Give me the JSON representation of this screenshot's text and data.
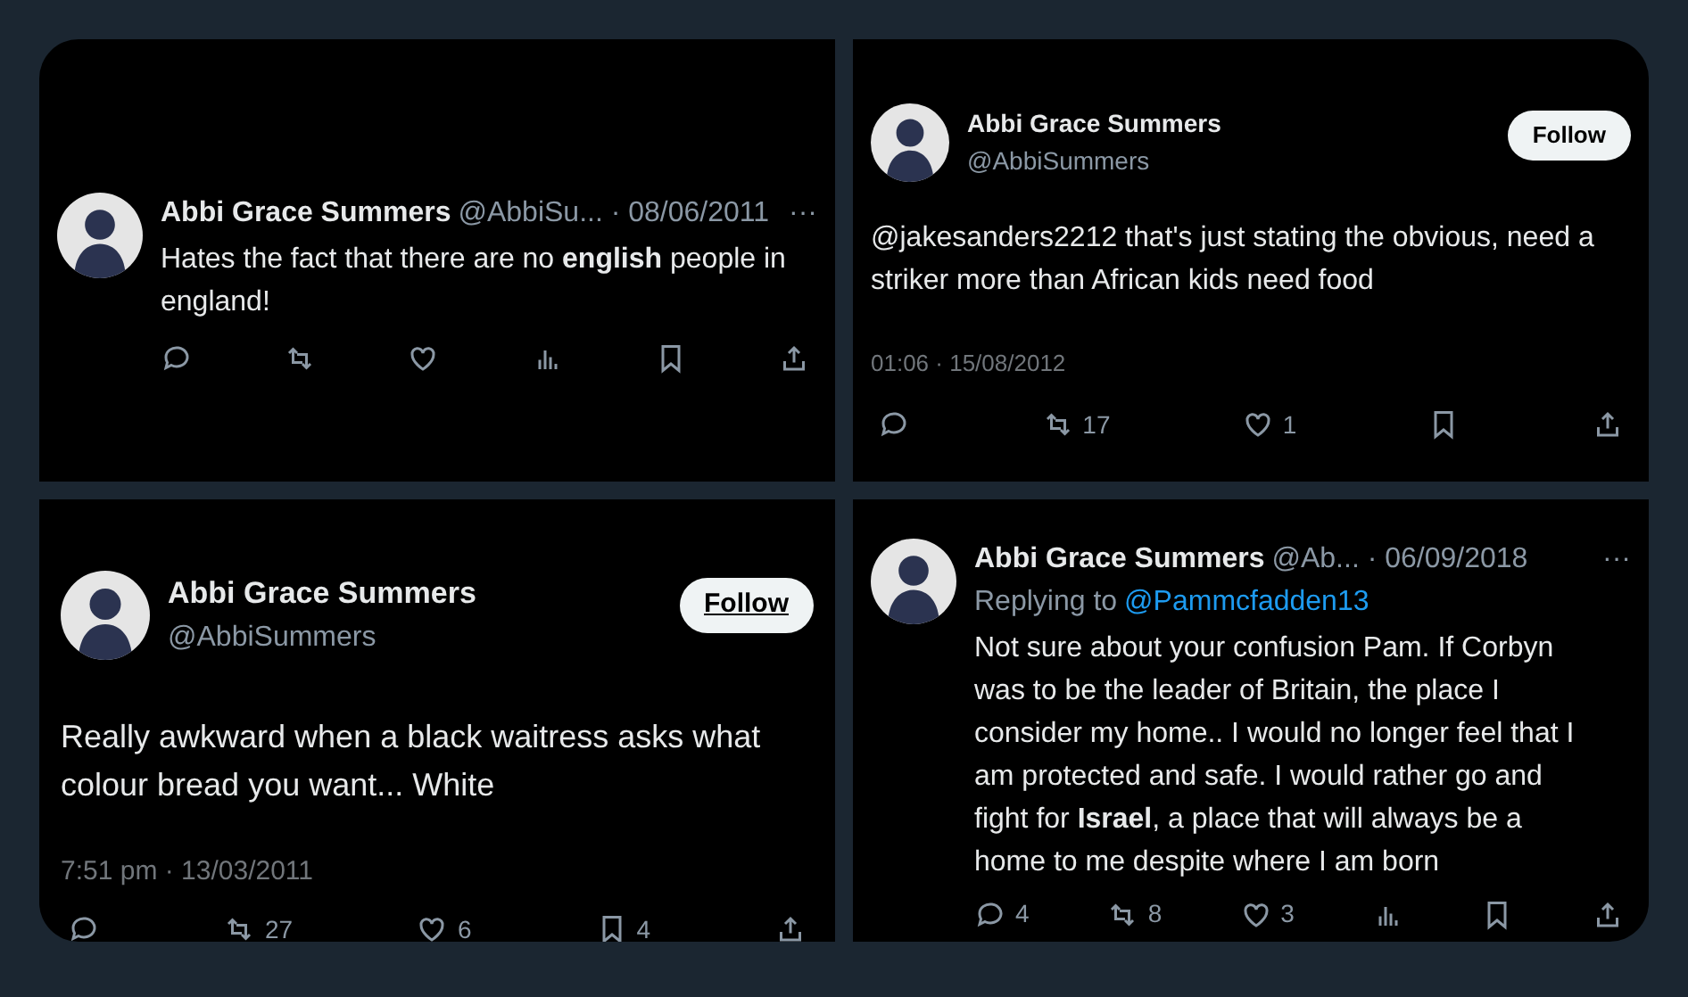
{
  "posts": [
    {
      "kind": "compact",
      "author": "Abbi Grace Summers",
      "handle_date": "@AbbiSu... · 08/06/2011",
      "more": "···",
      "text": "Hates the fact that there are no **english** people in england!",
      "actions": [
        {
          "kind": "reply"
        },
        {
          "kind": "repost"
        },
        {
          "kind": "like"
        },
        {
          "kind": "views"
        },
        {
          "kind": "bookmark"
        },
        {
          "kind": "share"
        }
      ]
    },
    {
      "kind": "full",
      "author": "Abbi Grace Summers",
      "handle": "@AbbiSummers",
      "follow": "Follow",
      "text": "@jakesanders2212 that's just stating the obvious, need a striker more than African kids need food",
      "timestamp": "01:06 · 15/08/2012",
      "actions": [
        {
          "kind": "reply"
        },
        {
          "kind": "repost",
          "count": "17"
        },
        {
          "kind": "like",
          "count": "1"
        },
        {
          "kind": "bookmark"
        },
        {
          "kind": "share"
        }
      ]
    },
    {
      "kind": "full",
      "author": "Abbi Grace Summers",
      "handle": "@AbbiSummers",
      "follow": "Follow",
      "text": "Really awkward when a black waitress asks what colour bread you want... White",
      "timestamp": "7:51 pm · 13/03/2011",
      "actions": [
        {
          "kind": "reply"
        },
        {
          "kind": "repost",
          "count": "27"
        },
        {
          "kind": "like",
          "count": "6"
        },
        {
          "kind": "bookmark",
          "count": "4"
        },
        {
          "kind": "share"
        }
      ]
    },
    {
      "kind": "compact",
      "author": "Abbi Grace Summers",
      "handle_date": "@Ab... · 06/09/2018",
      "more": "···",
      "replying_label": "Replying to",
      "replying_to": "@Pammcfadden13",
      "text": "Not sure about your confusion Pam. If Corbyn was to be the leader of Britain, the place I consider my home.. I would no longer feel that I am protected and safe. I would rather go and fight for **Israel**, a place that will always be a home to me despite where I am born",
      "actions": [
        {
          "kind": "reply",
          "count": "4"
        },
        {
          "kind": "repost",
          "count": "8"
        },
        {
          "kind": "like",
          "count": "3"
        },
        {
          "kind": "views"
        },
        {
          "kind": "bookmark"
        },
        {
          "kind": "share"
        }
      ]
    }
  ]
}
